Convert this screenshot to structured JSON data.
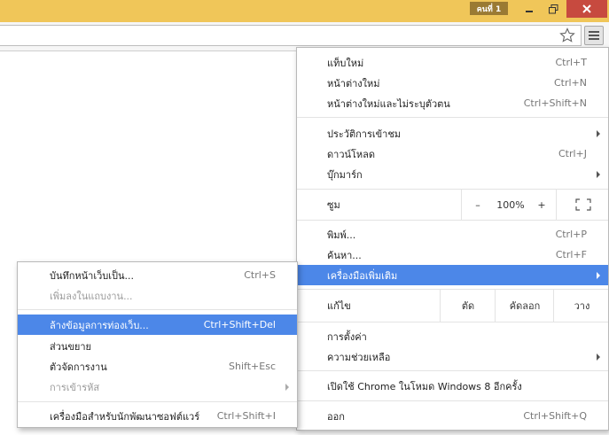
{
  "titlebar": {
    "user_badge": "คนที่ 1",
    "minimize_glyph": "_"
  },
  "menu": {
    "items_group1": [
      {
        "label": "แท็บใหม่",
        "shortcut": "Ctrl+T"
      },
      {
        "label": "หน้าต่างใหม่",
        "shortcut": "Ctrl+N"
      },
      {
        "label": "หน้าต่างใหม่และไม่ระบุตัวตน",
        "shortcut": "Ctrl+Shift+N"
      }
    ],
    "items_group2": [
      {
        "label": "ประวัติการเข้าชม",
        "shortcut": ""
      },
      {
        "label": "ดาวน์โหลด",
        "shortcut": "Ctrl+J"
      },
      {
        "label": "บุ๊กมาร์ก",
        "shortcut": ""
      }
    ],
    "zoom": {
      "label": "ซูม",
      "minus": "–",
      "value": "100%",
      "plus": "+"
    },
    "items_group3": [
      {
        "label": "พิมพ์...",
        "shortcut": "Ctrl+P"
      },
      {
        "label": "ค้นหา...",
        "shortcut": "Ctrl+F"
      },
      {
        "label": "เครื่องมือเพิ่มเติม",
        "shortcut": ""
      }
    ],
    "edit": {
      "label": "แก้ไข",
      "cut": "ตัด",
      "copy": "คัดลอก",
      "paste": "วาง"
    },
    "items_group4": [
      {
        "label": "การตั้งค่า",
        "shortcut": ""
      },
      {
        "label": "ความช่วยเหลือ",
        "shortcut": ""
      }
    ],
    "relaunch": {
      "label": "เปิดใช้ Chrome ในโหมด Windows 8 อีกครั้ง"
    },
    "exit": {
      "label": "ออก",
      "shortcut": "Ctrl+Shift+Q"
    }
  },
  "submenu": {
    "items_group1": [
      {
        "label": "บันทึกหน้าเว็บเป็น...",
        "shortcut": "Ctrl+S"
      },
      {
        "label": "เพิ่มลงในแถบงาน...",
        "shortcut": ""
      }
    ],
    "items_group2": [
      {
        "label": "ล้างข้อมูลการท่องเว็บ...",
        "shortcut": "Ctrl+Shift+Del"
      },
      {
        "label": "ส่วนขยาย",
        "shortcut": ""
      },
      {
        "label": "ตัวจัดการงาน",
        "shortcut": "Shift+Esc"
      },
      {
        "label": "การเข้ารหัส",
        "shortcut": ""
      }
    ],
    "items_group3": [
      {
        "label": "เครื่องมือสำหรับนักพัฒนาซอฟต์แวร์",
        "shortcut": "Ctrl+Shift+I"
      }
    ]
  },
  "colors": {
    "titlebar": "#f0c659",
    "highlight": "#4c87e8",
    "close_button": "#c74a3f"
  }
}
